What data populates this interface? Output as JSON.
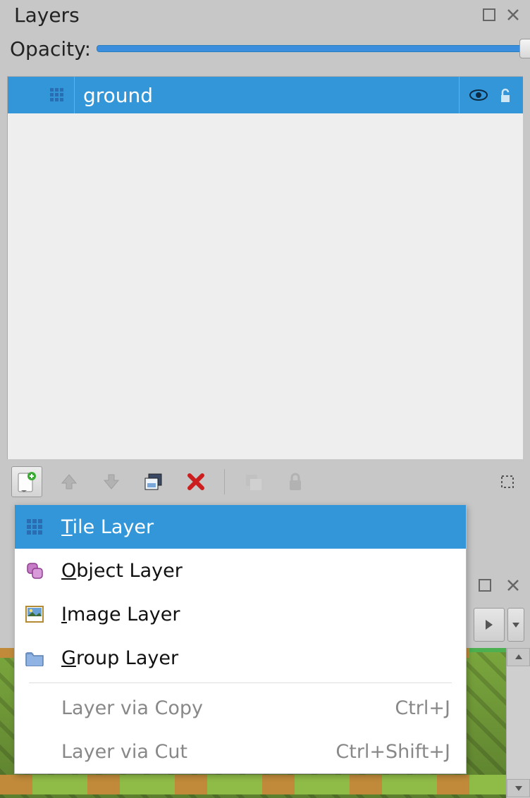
{
  "panel": {
    "title": "Layers",
    "opacity_label": "Opacity:",
    "opacity_value": 100
  },
  "layers": [
    {
      "name": "ground",
      "type": "tile",
      "visible": true,
      "locked": false,
      "selected": true
    }
  ],
  "toolbar": {
    "new_layer": "New Layer",
    "move_up": "Move Layer Up",
    "move_down": "Move Layer Down",
    "duplicate": "Duplicate Layer",
    "delete": "Remove Layer",
    "merge": "Merge Layer Down",
    "lock": "Lock Layer",
    "highlight": "Highlight Current Layer"
  },
  "menu": {
    "items": [
      {
        "icon": "grid",
        "label": "Tile Layer",
        "mnemonic": "T",
        "shortcut": "",
        "enabled": true,
        "hover": true
      },
      {
        "icon": "object",
        "label": "Object Layer",
        "mnemonic": "O",
        "shortcut": "",
        "enabled": true,
        "hover": false
      },
      {
        "icon": "image",
        "label": "Image Layer",
        "mnemonic": "I",
        "shortcut": "",
        "enabled": true,
        "hover": false
      },
      {
        "icon": "folder",
        "label": "Group Layer",
        "mnemonic": "G",
        "shortcut": "",
        "enabled": true,
        "hover": false
      },
      {
        "separator": true
      },
      {
        "icon": "",
        "label": "Layer via Copy",
        "shortcut": "Ctrl+J",
        "enabled": false
      },
      {
        "icon": "",
        "label": "Layer via Cut",
        "shortcut": "Ctrl+Shift+J",
        "enabled": false
      }
    ]
  }
}
